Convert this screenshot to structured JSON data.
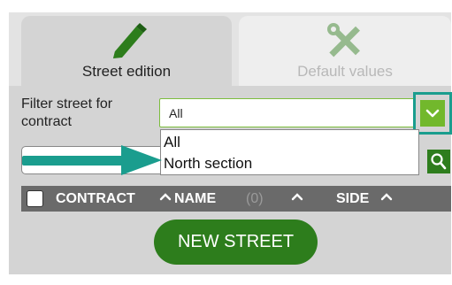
{
  "tabs": [
    {
      "label": "Street edition",
      "icon": "pencil-icon",
      "active": true
    },
    {
      "label": "Default values",
      "icon": "tools-icon",
      "active": false
    }
  ],
  "filter": {
    "label": "Filter street for contract",
    "selected": "All",
    "options": [
      "All",
      "North section"
    ]
  },
  "table_header": {
    "contract": "CONTRACT",
    "name": "NAME",
    "count": "(0)",
    "side": "SIDE"
  },
  "new_street_label": "NEW STREET",
  "colors": {
    "accent_green": "#72b82c",
    "dark_green": "#2d7d1c",
    "teal": "#1a9d8e",
    "header_bar": "#6a6a6a"
  }
}
